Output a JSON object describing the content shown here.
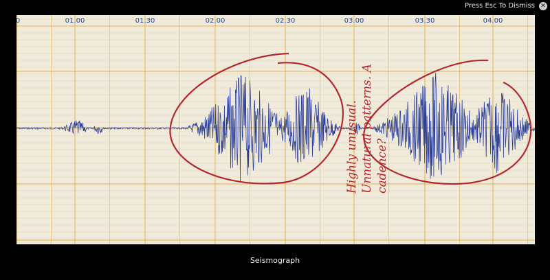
{
  "overlay": {
    "dismiss_hint": "Press Esc To Dismiss",
    "close_icon_glyph": "✕"
  },
  "seismograph": {
    "time_labels": [
      "0",
      "01.00",
      "01.30",
      "02.00",
      "02.30",
      "03.00",
      "03.30",
      "04.00"
    ],
    "annotation_text": "Highly unusual. Unnatural patterns. A cadence?",
    "colors": {
      "paper": "#efeadb",
      "grid_minor": "#e3d7a0",
      "grid_major": "#e6b04a",
      "trace": "#2b3f9a",
      "annotation": "#b0282e"
    }
  },
  "caption": "Seismograph"
}
